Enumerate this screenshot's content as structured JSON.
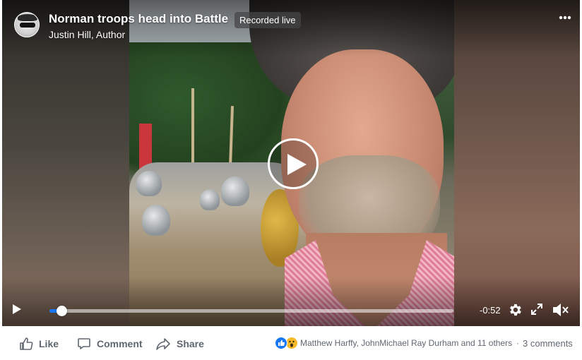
{
  "video": {
    "title": "Norman troops head into Battle",
    "live_badge": "Recorded live",
    "author": "Justin Hill, Author",
    "more_icon": "more-dots-icon",
    "time_remaining": "-0:52",
    "progress_fraction": 0.03
  },
  "actions": {
    "like_label": "Like",
    "comment_label": "Comment",
    "share_label": "Share"
  },
  "engagement": {
    "reactors_text": "Matthew Harffy, JohnMichael Ray Durham and 11 others",
    "separator": "·",
    "comments_text": "3 comments",
    "reaction_icons": [
      "like-icon",
      "wow-icon"
    ]
  },
  "colors": {
    "accent": "#1877f2",
    "action_text": "#606770",
    "wow": "#f7b928"
  }
}
